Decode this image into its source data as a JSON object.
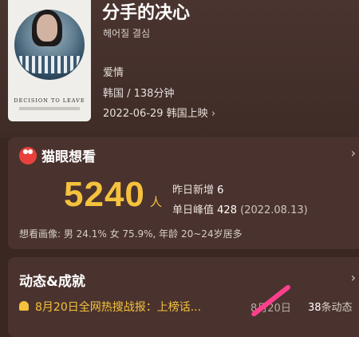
{
  "movie": {
    "title": "分手的决心",
    "original_title": "헤어질 결심",
    "genre": "爱情",
    "country_duration": "韩国 / 138分钟",
    "release": "2022-06-29 韩国上映",
    "poster_caption": "DECISION TO LEAVE"
  },
  "want_to_see": {
    "title": "猫眼想看",
    "count": "5240",
    "unit": "人",
    "yesterday_label": "昨日新增",
    "yesterday_value": "6",
    "peak_label": "单日峰值",
    "peak_value": "428",
    "peak_date": "(2022.08.13)",
    "profile": "想看画像: 男 24.1%  女 75.9%, 年龄 20~24岁居多"
  },
  "achievements": {
    "title": "动态&成就",
    "headline": "8月20日全网热搜战报：上榜话...",
    "date": "8月20日",
    "count": "38",
    "count_unit": "条动态"
  },
  "icons": {
    "arrow": "chevron-right-icon",
    "logo": "maoyan-cat-icon",
    "bell": "bell-icon"
  },
  "colors": {
    "accent": "#f5c23d",
    "background": "#3a2722",
    "brand_red": "#e8413b"
  }
}
